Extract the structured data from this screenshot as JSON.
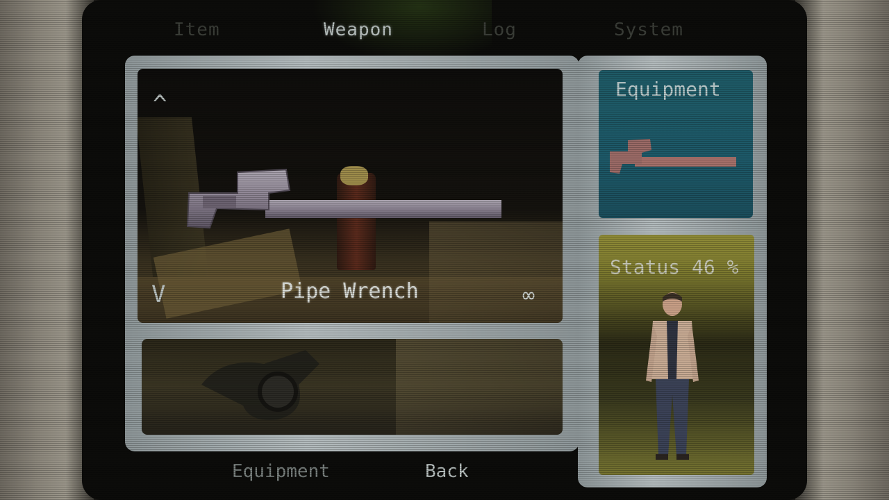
{
  "tabs": [
    {
      "label": "Item",
      "state": "inactive"
    },
    {
      "label": "Weapon",
      "state": "active"
    },
    {
      "label": "Log",
      "state": "inactive"
    },
    {
      "label": "System",
      "state": "inactive"
    }
  ],
  "viewer": {
    "up_arrow": "^",
    "down_arrow": "V",
    "item_name": "Pipe Wrench",
    "ammo": "∞"
  },
  "equipment_panel": {
    "title": "Equipment",
    "equipped_icon": "pipe-wrench-icon"
  },
  "status_panel": {
    "label": "Status",
    "value": "46 %",
    "color": "#8e8a37"
  },
  "bottom_actions": {
    "equipment_label": "Equipment",
    "back_label": "Back"
  },
  "colors": {
    "equipment_panel": "#1e5a66",
    "status_panel": "#8e8a37",
    "frame": "#a7afb1",
    "active_text": "#b8c0bf"
  }
}
